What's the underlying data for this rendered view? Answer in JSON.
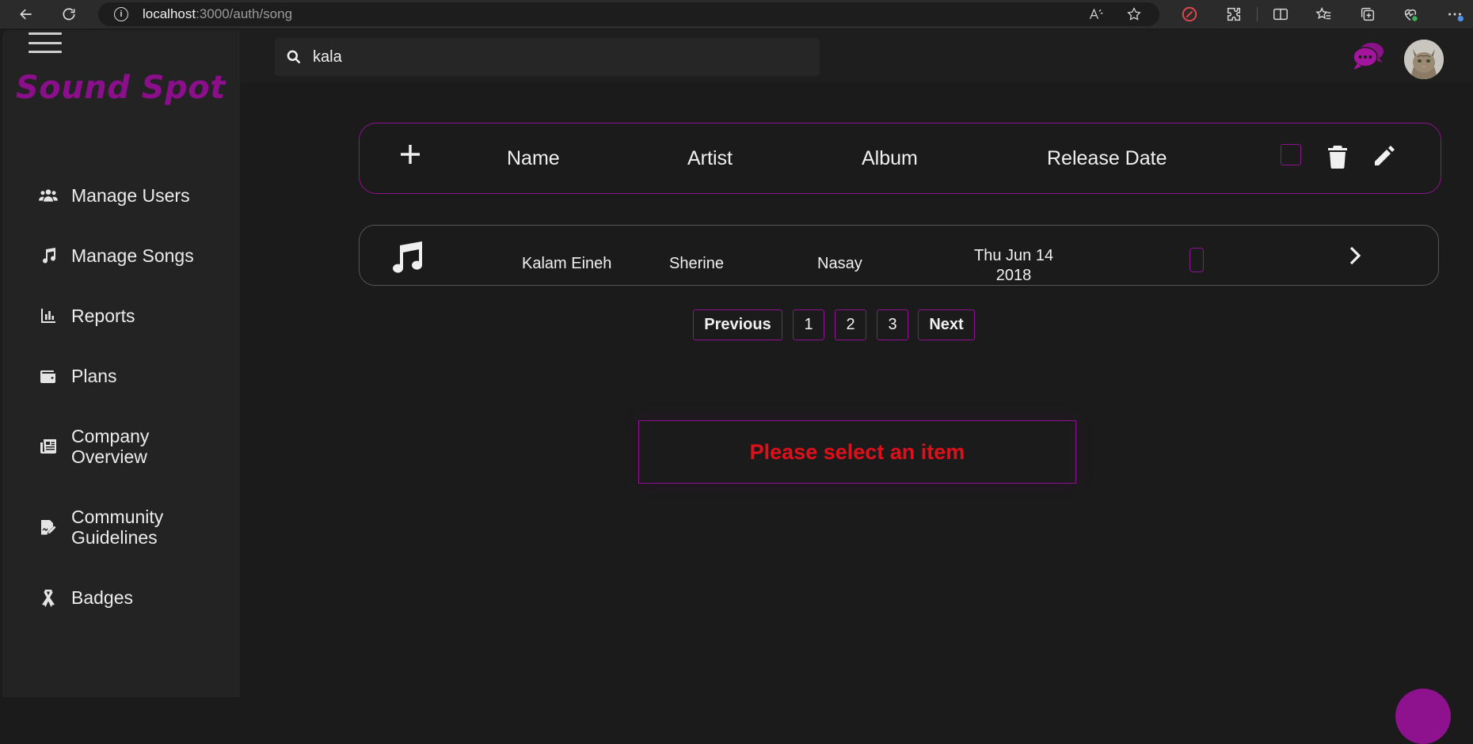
{
  "browser": {
    "url_host": "localhost",
    "url_path": ":3000/auth/song"
  },
  "brand": {
    "name": "Sound Spot",
    "color": "#8b0f8b"
  },
  "sidebar": {
    "items": [
      {
        "label": "Manage Users",
        "icon": "users-icon"
      },
      {
        "label": "Manage Songs",
        "icon": "music-note-icon"
      },
      {
        "label": "Reports",
        "icon": "bar-chart-icon"
      },
      {
        "label": "Plans",
        "icon": "wallet-icon"
      },
      {
        "label": "Company\nOverview",
        "icon": "newspaper-icon"
      },
      {
        "label": "Community\nGuidelines",
        "icon": "signature-icon"
      },
      {
        "label": "Badges",
        "icon": "ribbon-icon"
      }
    ]
  },
  "search": {
    "value": "kala",
    "placeholder": ""
  },
  "table": {
    "columns": [
      "Name",
      "Artist",
      "Album",
      "Release Date"
    ],
    "rows": [
      {
        "name": "Kalam Eineh",
        "artist": "Sherine",
        "album": "Nasay",
        "release_line1": "Thu Jun 14",
        "release_line2": "2018"
      }
    ]
  },
  "pagination": {
    "previous_label": "Previous",
    "pages": [
      "1",
      "2",
      "3"
    ],
    "next_label": "Next"
  },
  "message": {
    "text": "Please select an item",
    "color": "#e0101a"
  },
  "colors": {
    "accent": "#8e118e",
    "background": "#1b1b1b",
    "sidebar": "#232323"
  }
}
